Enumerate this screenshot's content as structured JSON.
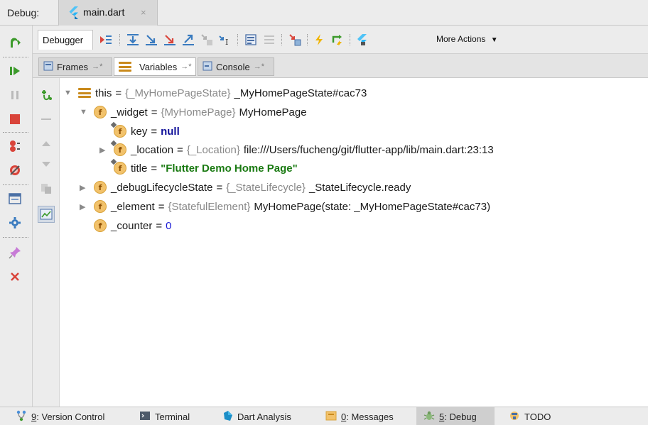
{
  "window": {
    "debug_label": "Debug:",
    "run_tab_title": "main.dart",
    "run_tab_close": "×"
  },
  "toolbar": {
    "debugger_tab": "Debugger",
    "more_actions": "More Actions"
  },
  "subtabs": [
    {
      "label": "Frames",
      "pin": "→*"
    },
    {
      "label": "Variables",
      "pin": "→*"
    },
    {
      "label": "Console",
      "pin": "→*"
    }
  ],
  "variables": {
    "root": {
      "name": "this",
      "type": "{_MyHomePageState}",
      "value": "_MyHomePageState#cac73"
    },
    "widget": {
      "name": "_widget",
      "type": "{MyHomePage}",
      "value": "MyHomePage"
    },
    "key": {
      "name": "key",
      "value": "null"
    },
    "location": {
      "name": "_location",
      "type": "{_Location}",
      "value": "file:///Users/fucheng/git/flutter-app/lib/main.dart:23:13"
    },
    "title": {
      "name": "title",
      "value": "\"Flutter Demo Home Page\""
    },
    "lifecycle": {
      "name": "_debugLifecycleState",
      "type": "{_StateLifecycle}",
      "value": "_StateLifecycle.ready"
    },
    "element": {
      "name": "_element",
      "type": "{StatefulElement}",
      "value": "MyHomePage(state: _MyHomePageState#cac73)"
    },
    "counter": {
      "name": "_counter",
      "value": "0"
    },
    "eq": "=",
    "badge": "f"
  },
  "statusbar": {
    "version_control": {
      "num": "9",
      "rest": ": Version Control"
    },
    "terminal": "Terminal",
    "dart_analysis": "Dart Analysis",
    "messages": {
      "num": "0",
      "rest": ": Messages"
    },
    "debug": {
      "num": "5",
      "rest": ": Debug"
    },
    "todo": "TODO"
  },
  "colors": {
    "accent_green": "#3c9a2b",
    "stop_red": "#d9443a",
    "string_green": "#1a7a12",
    "keyword_navy": "#10109a",
    "number_blue": "#1a1ad6",
    "field_badge": "#f2c26b"
  }
}
